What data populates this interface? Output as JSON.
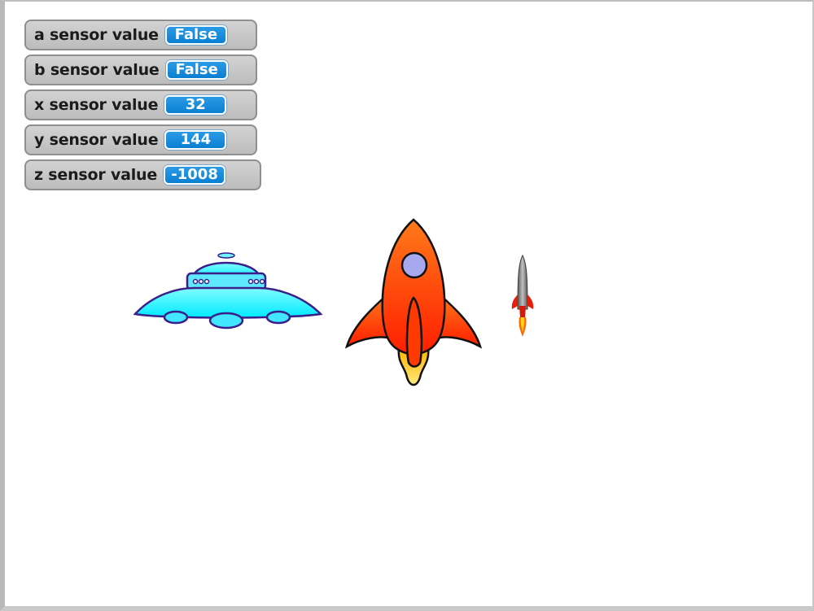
{
  "watchers": [
    {
      "label": "a sensor value",
      "value": "False"
    },
    {
      "label": "b sensor value",
      "value": "False"
    },
    {
      "label": "x sensor value",
      "value": "32"
    },
    {
      "label": "y sensor value",
      "value": "144"
    },
    {
      "label": "z sensor value",
      "value": "-1008"
    }
  ],
  "sprites": [
    {
      "name": "ufo",
      "icon": "ufo-icon"
    },
    {
      "name": "rocket",
      "icon": "rocket-icon"
    },
    {
      "name": "small-rocket",
      "icon": "small-rocket-icon"
    }
  ],
  "colors": {
    "watcher_bg": "#c8c8c8",
    "value_bg": "#1a8ad8",
    "ufo": "#00ffff",
    "ufo_outline": "#3a1e8a",
    "rocket": "#ff5a00",
    "flame": "#ffd21a"
  }
}
